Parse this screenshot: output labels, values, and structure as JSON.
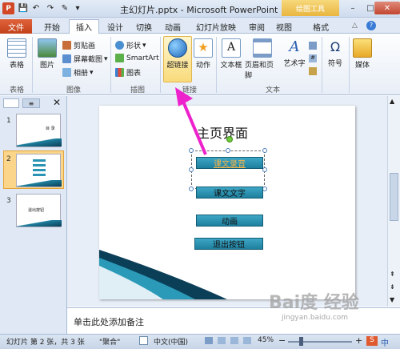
{
  "window": {
    "title": "主幻灯片.pptx - Microsoft PowerPoint",
    "context_tab_group": "绘图工具",
    "logo": "P",
    "controls": [
      "–",
      "□",
      "✕"
    ]
  },
  "tabs": [
    "文件",
    "开始",
    "插入",
    "设计",
    "切换",
    "动画",
    "幻灯片放映",
    "审阅",
    "视图",
    "格式"
  ],
  "active_tab": "插入",
  "ribbon": {
    "groups": [
      "表格",
      "图像",
      "插图",
      "链接",
      "文本"
    ],
    "table": {
      "label": "表格"
    },
    "images": {
      "picture": "图片",
      "clip_art": "剪贴画",
      "screenshot": "屏幕截图",
      "album": "相册"
    },
    "illustrations": {
      "shapes": "形状",
      "smartart": "SmartArt",
      "chart": "图表"
    },
    "links": {
      "hyperlink": "超链接",
      "action": "动作"
    },
    "text": {
      "textbox": "文本框",
      "header_footer": "页眉和页脚",
      "wordart": "艺术字"
    },
    "symbols": {
      "symbol": "符号"
    },
    "media": {
      "media": "媒体"
    }
  },
  "slides_panel": {
    "numbers": [
      "1",
      "2",
      "3"
    ],
    "thumb1_text": "目 录",
    "thumb3_text": "退出按钮"
  },
  "slide": {
    "title": "主页界面",
    "buttons": [
      "课文录音",
      "课文文字",
      "动画",
      "退出按钮"
    ]
  },
  "notes_placeholder": "单击此处添加备注",
  "statusbar": {
    "slide_info": "幻灯片 第 2 张，共 3 张",
    "theme": "\"聚合\"",
    "language": "中文(中国)",
    "zoom": "45%",
    "zoom_percent": 45
  },
  "watermark": {
    "logo": "Bai度 经验",
    "url": "jingyan.baidu.com"
  },
  "colors": {
    "accent_file": "#d24726",
    "slide_button": "#2b93b3",
    "arrow": "#ee22cc",
    "link_text": "#f6b54a"
  }
}
